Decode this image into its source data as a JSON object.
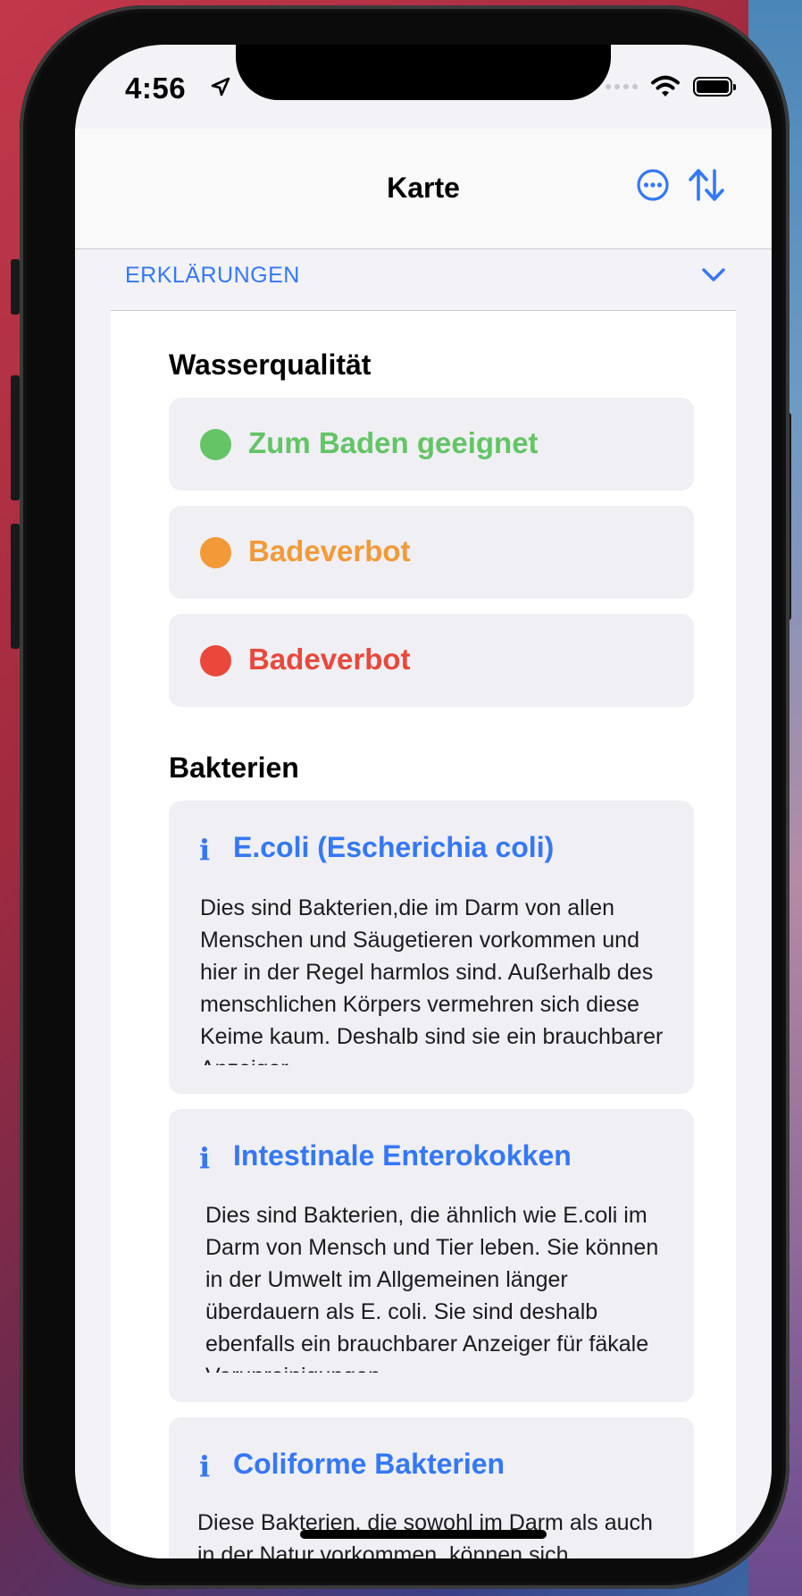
{
  "status_bar": {
    "time": "4:56"
  },
  "navbar": {
    "title": "Karte"
  },
  "section": {
    "label": "ERKLÄRUNGEN"
  },
  "water_quality": {
    "title": "Wasserqualität",
    "items": [
      {
        "label": "Zum Baden geeignet",
        "color": "#64c466"
      },
      {
        "label": "Badeverbot",
        "color": "#f19a37"
      },
      {
        "label": "Badeverbot",
        "color": "#e9483b"
      }
    ]
  },
  "bacteria": {
    "title": "Bakterien",
    "items": [
      {
        "icon": "info-icon",
        "title": "E.coli (Escherichia coli)",
        "text": "Dies sind Bakterien,die im Darm von allen Menschen und Säugetieren vorkommen und hier in der Regel harmlos sind. Außerhalb des menschlichen Körpers vermehren sich diese Keime kaum. Deshalb sind sie ein brauchbarer Anzeiger"
      },
      {
        "icon": "info-icon",
        "title": "Intestinale Enterokokken",
        "text": "Dies sind Bakterien, die ähnlich wie E.coli im Darm von Mensch und Tier leben. Sie können in der Umwelt im Allgemeinen länger überdauern als E. coli. Sie sind deshalb ebenfalls ein brauchbarer Anzeiger für fäkale Verunreinigungen"
      },
      {
        "icon": "info-icon",
        "title": "Coliforme Bakterien",
        "text": "Diese Bakterien, die sowohl im Darm als auch in der Natur vorkommen, können sich"
      }
    ]
  },
  "colors": {
    "accent": "#3478f6"
  }
}
